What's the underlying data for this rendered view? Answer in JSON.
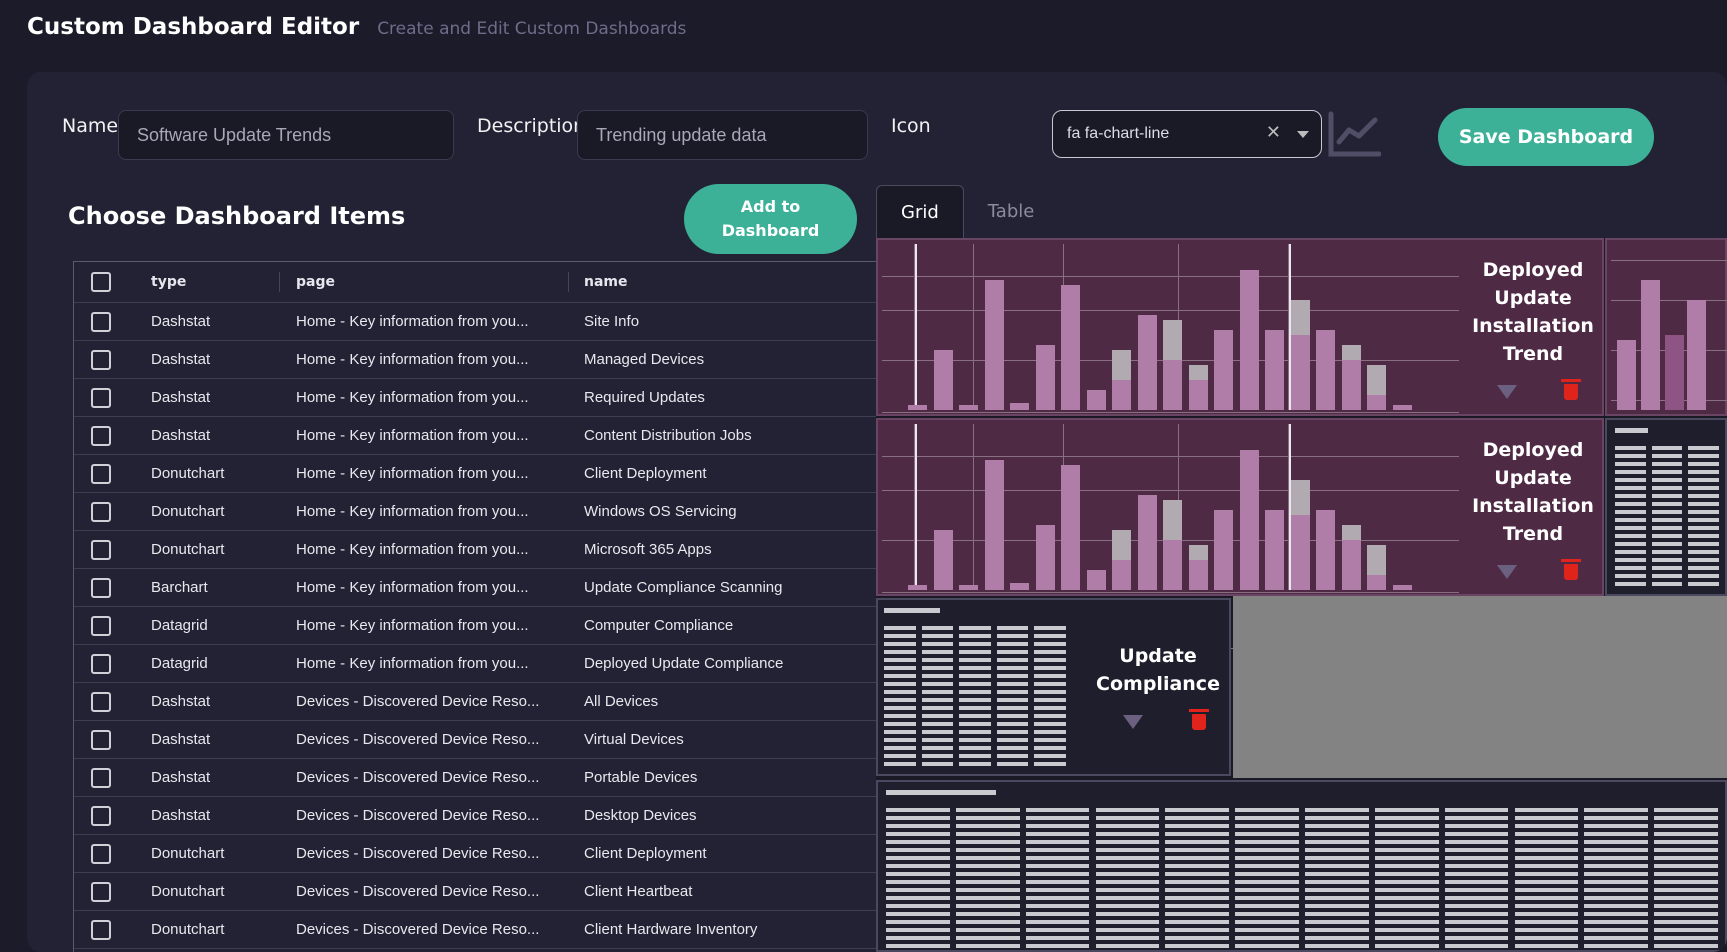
{
  "header": {
    "title": "Custom Dashboard Editor",
    "subtitle": "Create and Edit Custom Dashboards"
  },
  "form": {
    "name_label": "Name",
    "name_value": "Software Update Trends",
    "description_label": "Description",
    "description_value": "Trending update data",
    "icon_label": "Icon",
    "icon_value": "fa fa-chart-line",
    "icon_preview": "chart-line-icon",
    "save_label": "Save Dashboard"
  },
  "items": {
    "title": "Choose Dashboard Items",
    "add_label": "Add to Dashboard",
    "columns": [
      "type",
      "page",
      "name"
    ],
    "rows": [
      {
        "type": "Dashstat",
        "page": "Home - Key information from you...",
        "name": "Site Info"
      },
      {
        "type": "Dashstat",
        "page": "Home - Key information from you...",
        "name": "Managed Devices"
      },
      {
        "type": "Dashstat",
        "page": "Home - Key information from you...",
        "name": "Required Updates"
      },
      {
        "type": "Dashstat",
        "page": "Home - Key information from you...",
        "name": "Content Distribution Jobs"
      },
      {
        "type": "Donutchart",
        "page": "Home - Key information from you...",
        "name": "Client Deployment"
      },
      {
        "type": "Donutchart",
        "page": "Home - Key information from you...",
        "name": "Windows OS Servicing"
      },
      {
        "type": "Donutchart",
        "page": "Home - Key information from you...",
        "name": "Microsoft 365 Apps"
      },
      {
        "type": "Barchart",
        "page": "Home - Key information from you...",
        "name": "Update Compliance Scanning"
      },
      {
        "type": "Datagrid",
        "page": "Home - Key information from you...",
        "name": "Computer Compliance"
      },
      {
        "type": "Datagrid",
        "page": "Home - Key information from you...",
        "name": "Deployed Update Compliance"
      },
      {
        "type": "Dashstat",
        "page": "Devices - Discovered Device Reso...",
        "name": "All Devices"
      },
      {
        "type": "Dashstat",
        "page": "Devices - Discovered Device Reso...",
        "name": "Virtual Devices"
      },
      {
        "type": "Dashstat",
        "page": "Devices - Discovered Device Reso...",
        "name": "Portable Devices"
      },
      {
        "type": "Dashstat",
        "page": "Devices - Discovered Device Reso...",
        "name": "Desktop Devices"
      },
      {
        "type": "Donutchart",
        "page": "Devices - Discovered Device Reso...",
        "name": "Client Deployment"
      },
      {
        "type": "Donutchart",
        "page": "Devices - Discovered Device Reso...",
        "name": "Client Heartbeat"
      },
      {
        "type": "Donutchart",
        "page": "Devices - Discovered Device Reso...",
        "name": "Client Hardware Inventory"
      }
    ]
  },
  "preview": {
    "tabs": [
      "Grid",
      "Table"
    ],
    "active_tab": "Grid",
    "widgets": [
      {
        "title": "Deployed Update Installation Trend"
      },
      {
        "title": "Deployed Update Installation Trend"
      },
      {
        "title": "Update Compliance"
      }
    ],
    "colors": {
      "chart_bg": "#4e2a45",
      "bar": "#b07ca8",
      "bar_gray": "#b1aab1",
      "accent": "#3db198",
      "delete": "#e0241b"
    }
  }
}
